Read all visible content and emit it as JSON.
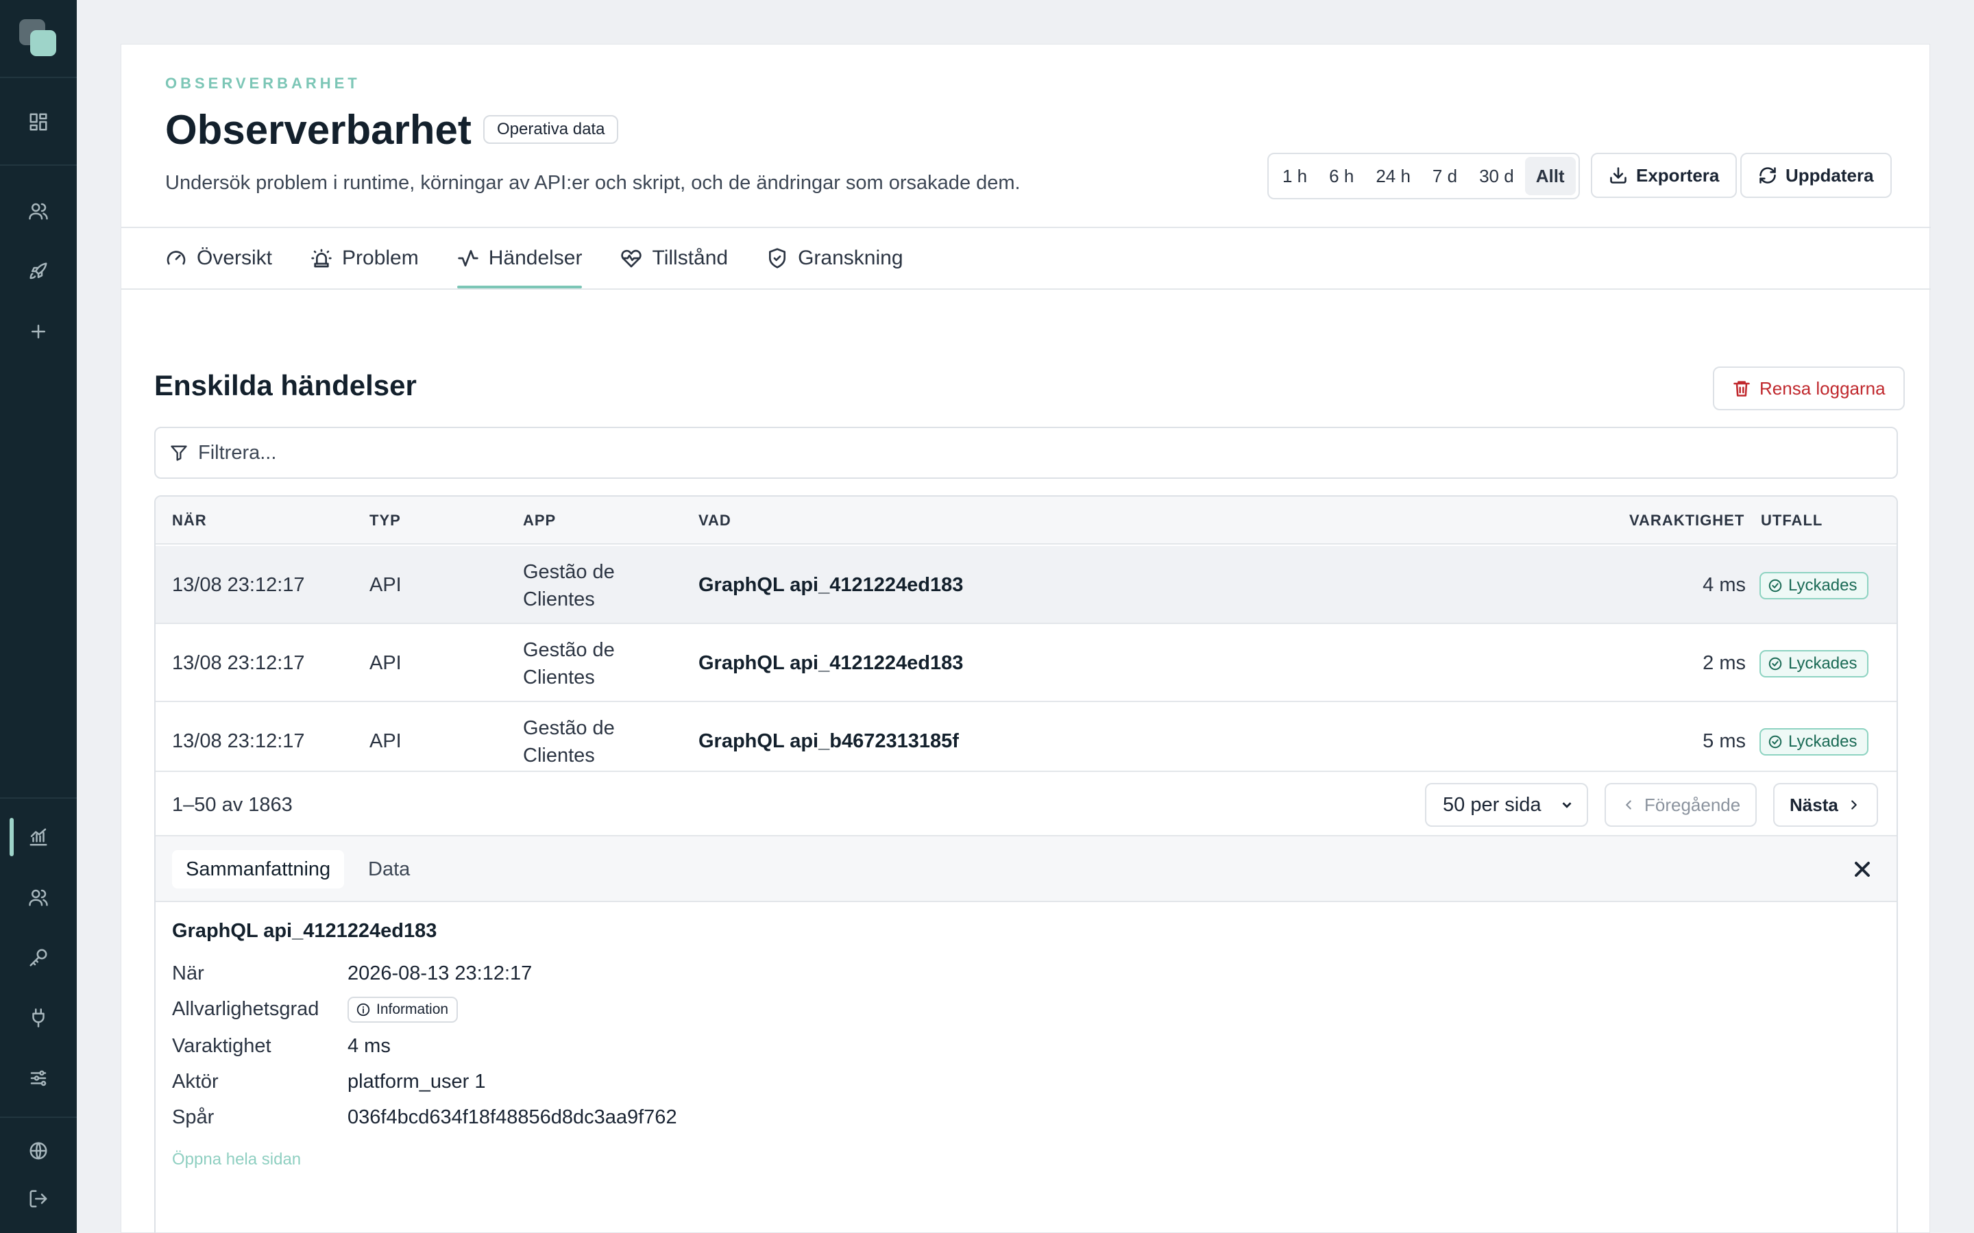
{
  "header": {
    "eyebrow": "OBSERVERBARHET",
    "title": "Observerbarhet",
    "badge": "Operativa data",
    "subtitle": "Undersök problem i runtime, körningar av API:er och skript, och de ändringar som orsakade dem."
  },
  "time_ranges": [
    "1 h",
    "6 h",
    "24 h",
    "7 d",
    "30 d",
    "Allt"
  ],
  "time_range_active": "Allt",
  "actions": {
    "export_label": "Exportera",
    "refresh_label": "Uppdatera"
  },
  "tabs": [
    {
      "label": "Översikt",
      "icon": "gauge-icon"
    },
    {
      "label": "Problem",
      "icon": "siren-icon"
    },
    {
      "label": "Händelser",
      "icon": "activity-icon",
      "active": true
    },
    {
      "label": "Tillstånd",
      "icon": "heart-pulse-icon"
    },
    {
      "label": "Granskning",
      "icon": "shield-check-icon"
    }
  ],
  "events": {
    "title": "Enskilda händelser",
    "clear_label": "Rensa loggarna",
    "filter_placeholder": "Filtrera...",
    "columns": {
      "when": "NÄR",
      "type": "TYP",
      "app": "APP",
      "what": "VAD",
      "duration": "VARAKTIGHET",
      "outcome": "UTFALL"
    },
    "rows": [
      {
        "when": "13/08 23:12:17",
        "type": "API",
        "app": "Gestão de Clientes",
        "what": "GraphQL api_4121224ed183",
        "duration": "4 ms",
        "outcome": "Lyckades"
      },
      {
        "when": "13/08 23:12:17",
        "type": "API",
        "app": "Gestão de Clientes",
        "what": "GraphQL api_4121224ed183",
        "duration": "2 ms",
        "outcome": "Lyckades"
      },
      {
        "when": "13/08 23:12:17",
        "type": "API",
        "app": "Gestão de Clientes",
        "what": "GraphQL api_b4672313185f",
        "duration": "5 ms",
        "outcome": "Lyckades"
      }
    ],
    "pagination": {
      "info": "1–50 av 1863",
      "per_page": "50 per sida",
      "prev_label": "Föregående",
      "next_label": "Nästa"
    }
  },
  "detail": {
    "tabs": [
      "Sammanfattning",
      "Data"
    ],
    "title": "GraphQL api_4121224ed183",
    "fields": {
      "when_label": "När",
      "when_value": "2026-08-13 23:12:17",
      "severity_label": "Allvarlighetsgrad",
      "severity_value": "Information",
      "duration_label": "Varaktighet",
      "duration_value": "4 ms",
      "actor_label": "Aktör",
      "actor_value": "platform_user 1",
      "trace_label": "Spår",
      "trace_value": "036f4bcd634f18f48856d8dc3aa9f762"
    },
    "open_full_label": "Öppna hela sidan"
  },
  "colors": {
    "sidebar": "#14262f",
    "accent": "#7cc6b6",
    "danger": "#c0282d",
    "success": "#1a6a55"
  }
}
